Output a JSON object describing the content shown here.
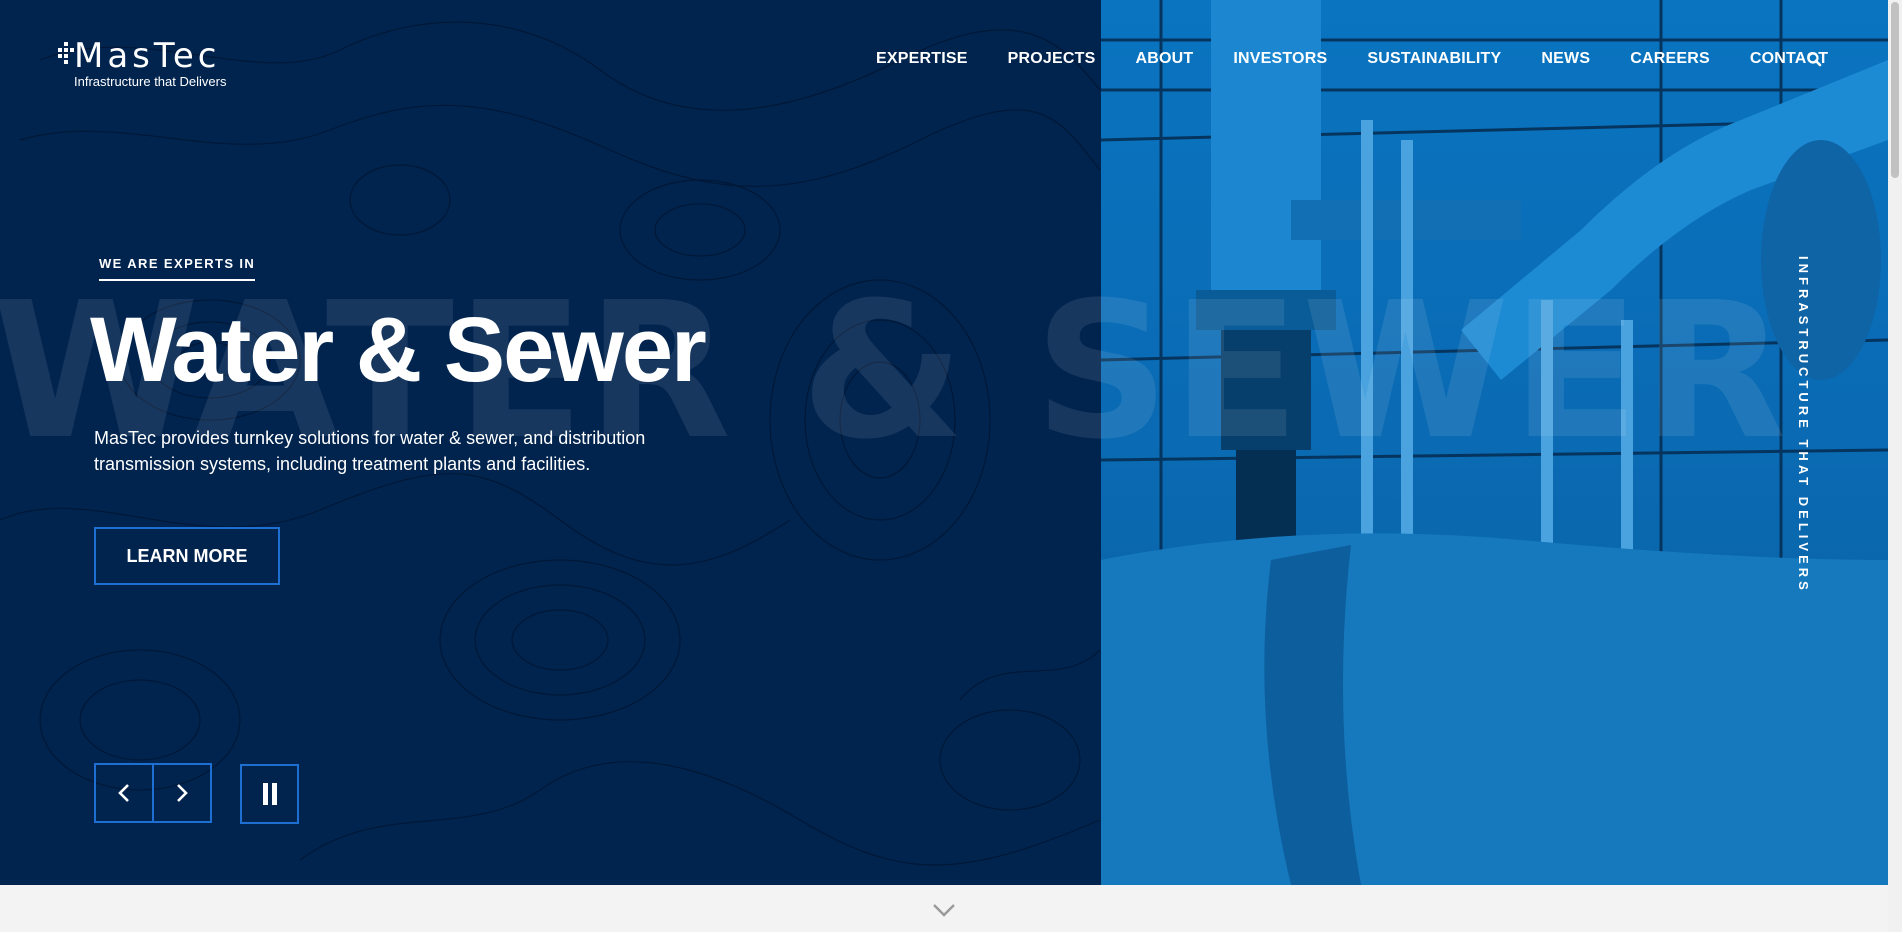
{
  "brand": {
    "name": "MasTec",
    "tagline": "Infrastructure that Delivers"
  },
  "nav": {
    "items": [
      {
        "label": "EXPERTISE"
      },
      {
        "label": "PROJECTS"
      },
      {
        "label": "ABOUT"
      },
      {
        "label": "INVESTORS"
      },
      {
        "label": "SUSTAINABILITY"
      },
      {
        "label": "NEWS"
      },
      {
        "label": "CAREERS"
      },
      {
        "label": "CONTACT"
      }
    ],
    "search_icon": "search-icon"
  },
  "hero": {
    "eyebrow": "WE ARE EXPERTS IN",
    "title": "Water & Sewer",
    "background_word": "WATER & SEWER",
    "description": "MasTec provides turnkey solutions for water & sewer, and distribution transmission systems, including treatment plants and facilities.",
    "cta_label": "LEARN MORE",
    "vertical_text": "INFRASTRUCTURE THAT DELIVERS"
  },
  "slider_controls": {
    "prev_icon": "chevron-left-icon",
    "next_icon": "chevron-right-icon",
    "pause_icon": "pause-icon"
  },
  "scroll_icon": "chevron-down-icon",
  "colors": {
    "hero_bg": "#01244f",
    "accent": "#1d6fd1",
    "photo_tint": "#0a6ab3",
    "text": "#ffffff"
  }
}
